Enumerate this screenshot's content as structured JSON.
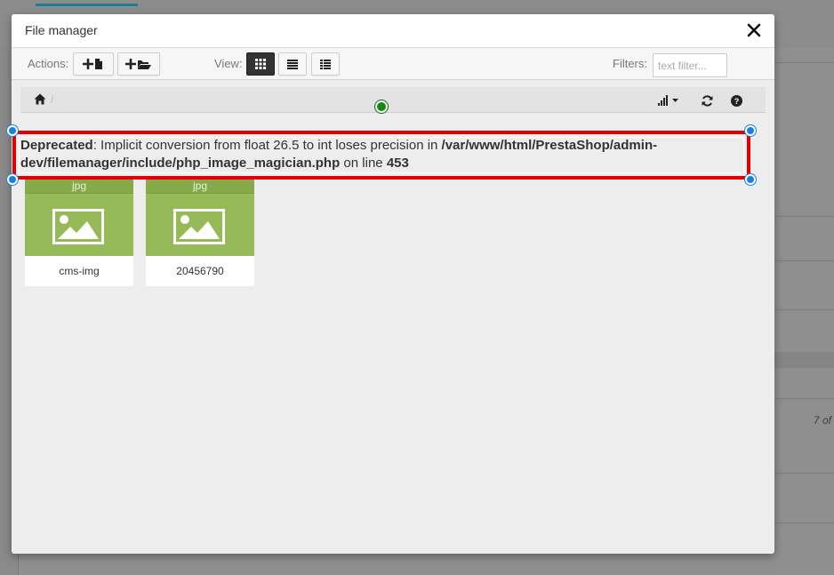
{
  "background": {
    "pager_text": "7 of"
  },
  "modal": {
    "title": "File manager"
  },
  "toolbar": {
    "actions_label": "Actions:",
    "view_label": "View:",
    "filters_label": "Filters:",
    "filter_placeholder": "text filter..."
  },
  "breadcrumb": {
    "separator": "/"
  },
  "notice": {
    "level": "Deprecated",
    "message": ": Implicit conversion from float 26.5 to int loses precision in ",
    "path": "/var/www/html/PrestaShop/admin-dev/filemanager/include/php_image_magician.php",
    "on_line": " on line ",
    "line": "453"
  },
  "files": [
    {
      "ext": "jpg",
      "name": "cms-img"
    },
    {
      "ext": "jpg",
      "name": "20456790"
    }
  ],
  "colors": {
    "thumb_green": "#97ba58",
    "selection_red": "#e00000",
    "handle_blue": "#1a7fe0",
    "rotate_green": "#148a14"
  }
}
